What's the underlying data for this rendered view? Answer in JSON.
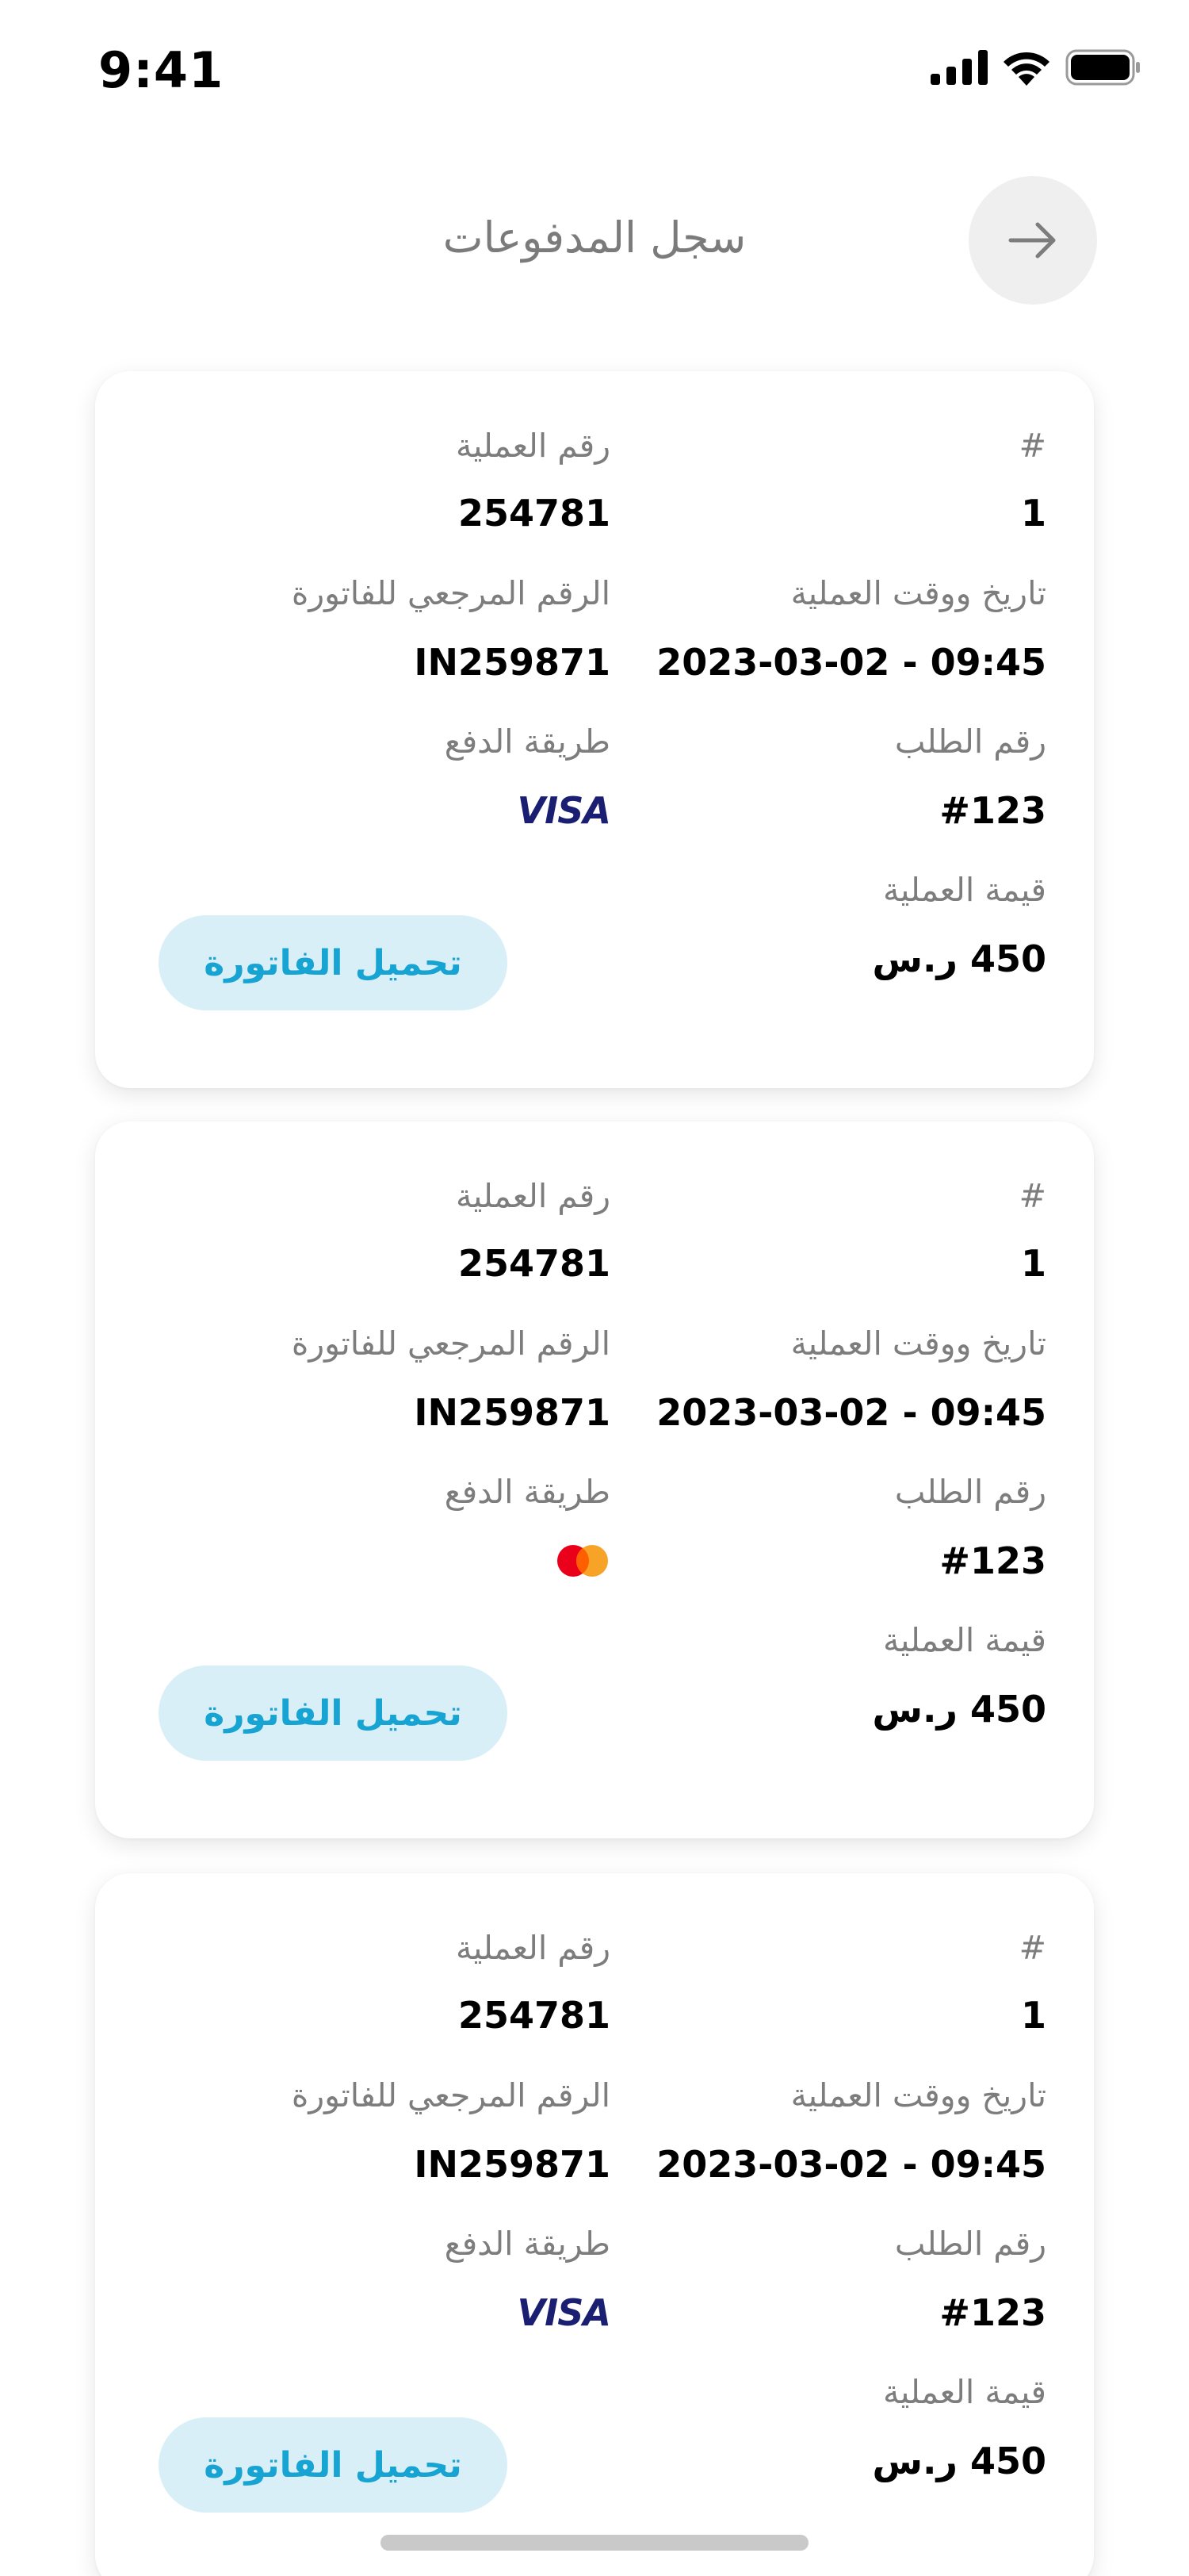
{
  "status_bar": {
    "time": "9:41"
  },
  "header": {
    "title": "سجل المدفوعات"
  },
  "labels": {
    "index": "#",
    "transaction_no": "رقم العملية",
    "transaction_time": "تاريخ ووقت العملية",
    "invoice_ref": "الرقم المرجعي للفاتورة",
    "order_no": "رقم الطلب",
    "payment_method": "طريقة الدفع",
    "amount": "قيمة العملية",
    "download": "تحميل الفاتورة"
  },
  "payments": [
    {
      "index": "1",
      "transaction_no": "254781",
      "transaction_time": "2023-03-02 - 09:45",
      "invoice_ref": "IN259871",
      "order_no": "#123",
      "payment_method": "visa",
      "visa_text": "VISA",
      "amount": "450 ر.س"
    },
    {
      "index": "1",
      "transaction_no": "254781",
      "transaction_time": "2023-03-02 - 09:45",
      "invoice_ref": "IN259871",
      "order_no": "#123",
      "payment_method": "mastercard",
      "amount": "450 ر.س"
    },
    {
      "index": "1",
      "transaction_no": "254781",
      "transaction_time": "2023-03-02 - 09:45",
      "invoice_ref": "IN259871",
      "order_no": "#123",
      "payment_method": "visa",
      "visa_text": "VISA",
      "amount": "450 ر.س"
    }
  ],
  "colors": {
    "accent": "#17a4d3",
    "accent_bg": "#d9eff8",
    "visa": "#1a1f71",
    "mc_red": "#eb001b",
    "mc_orange": "#f79e1b"
  }
}
